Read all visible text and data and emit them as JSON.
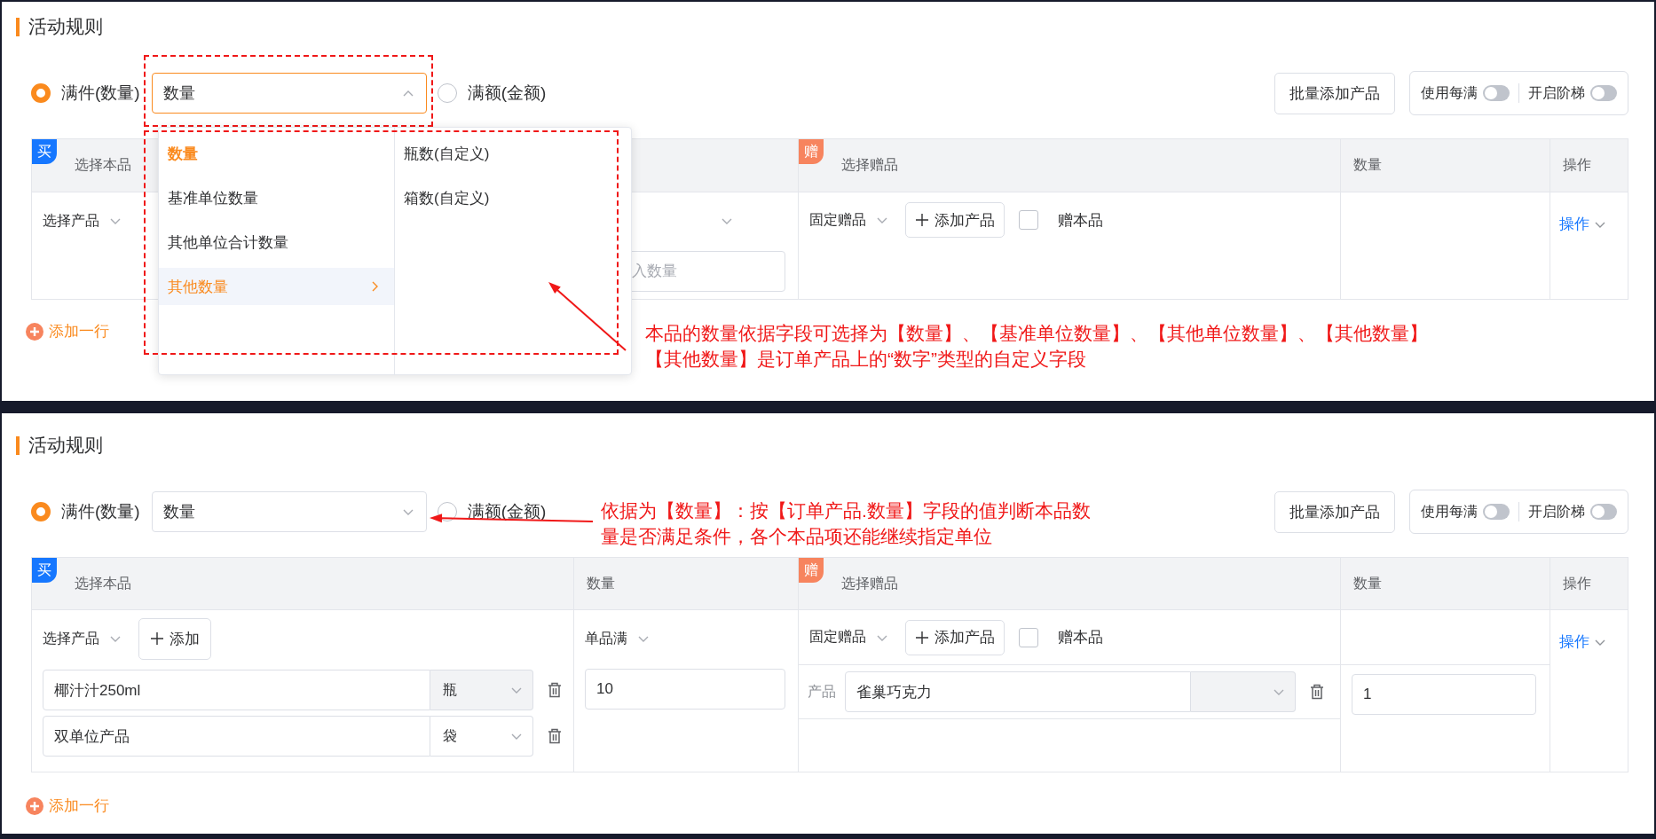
{
  "panels": [
    {
      "title": "活动规则",
      "conditions": [
        {
          "label": "满件(数量)",
          "selected": true
        },
        {
          "label": "满额(金额)",
          "selected": false
        }
      ],
      "basis_select": {
        "value": "数量",
        "expanded": true
      },
      "batch_button": "批量添加产品",
      "toggles": [
        {
          "label": "使用每满",
          "on": false
        },
        {
          "label": "开启阶梯",
          "on": false
        }
      ],
      "table": {
        "buy_badge": "买",
        "buy_header": "选择本品",
        "gift_badge": "赠",
        "gift_header": "选择赠品",
        "gift_qty_header": "数量",
        "action_header": "操作",
        "buy": {
          "product_select": "选择产品"
        },
        "qty": {
          "input_placeholder": "入数量"
        },
        "gift": {
          "gift_select": "固定赠品",
          "add_button": "添加产品",
          "gift_self": {
            "label": "赠本品",
            "checked": false
          }
        },
        "action": "操作"
      },
      "add_row": "添加一行",
      "dropdown": {
        "options": [
          {
            "label": "数量",
            "selected": true,
            "expanded": false
          },
          {
            "label": "基准单位数量",
            "selected": false,
            "expanded": false
          },
          {
            "label": "其他单位合计数量",
            "selected": false,
            "expanded": false
          },
          {
            "label": "其他数量",
            "selected": false,
            "expanded": true
          }
        ],
        "sub_options": [
          "瓶数(自定义)",
          "箱数(自定义)"
        ]
      },
      "annotation": [
        "本品的数量依据字段可选择为【数量】、【基准单位数量】、【其他单位数量】、【其他数量】",
        "【其他数量】是订单产品上的“数字”类型的自定义字段"
      ]
    },
    {
      "title": "活动规则",
      "conditions": [
        {
          "label": "满件(数量)",
          "selected": true
        },
        {
          "label": "满额(金额)",
          "selected": false
        }
      ],
      "basis_select": {
        "value": "数量",
        "expanded": false
      },
      "batch_button": "批量添加产品",
      "toggles": [
        {
          "label": "使用每满",
          "on": false
        },
        {
          "label": "开启阶梯",
          "on": false
        }
      ],
      "table": {
        "buy_badge": "买",
        "buy_header": "选择本品",
        "qty_header": "数量",
        "gift_badge": "赠",
        "gift_header": "选择赠品",
        "gift_qty_header": "数量",
        "action_header": "操作",
        "buy": {
          "product_select": "选择产品",
          "add_button": "添加",
          "items": [
            {
              "name": "椰汁汁250ml",
              "unit": "瓶",
              "disabled": true
            },
            {
              "name": "双单位产品",
              "unit": "袋",
              "disabled": false
            }
          ]
        },
        "qty": {
          "select": "单品满",
          "input_value": "10"
        },
        "gift": {
          "gift_select": "固定赠品",
          "add_button": "添加产品",
          "gift_self": {
            "label": "赠本品",
            "checked": false
          },
          "items": [
            {
              "label": "产品",
              "name": "雀巢巧克力",
              "disabled": true
            }
          ]
        },
        "gift_qty": [
          "1"
        ],
        "action": "操作"
      },
      "add_row": "添加一行",
      "annotation": [
        "依据为【数量】：按【订单产品.数量】字段的值判断本品数",
        "量是否满足条件，各个本品项还能继续指定单位"
      ]
    }
  ]
}
